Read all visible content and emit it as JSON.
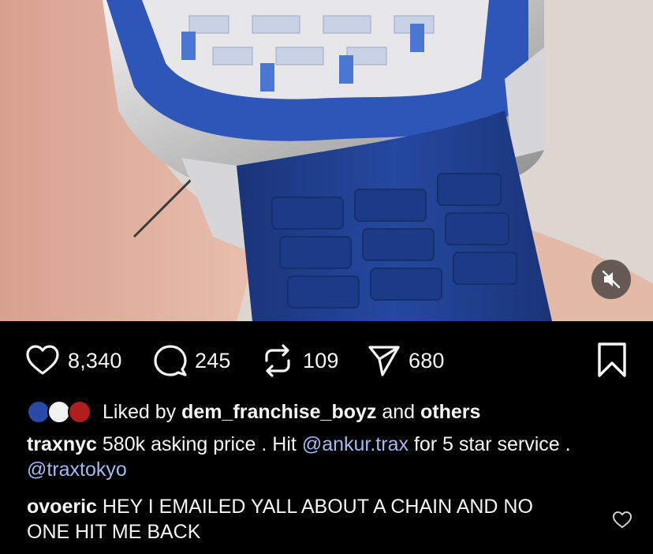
{
  "post": {
    "actions": {
      "likes": "8,340",
      "comments": "245",
      "reposts": "109",
      "shares": "680"
    },
    "liked_by": {
      "prefix": "Liked by",
      "user": "dem_franchise_boyz",
      "joiner": "and",
      "others": "others"
    },
    "caption": {
      "username": "traxnyc",
      "text_1": "580k asking price .  Hit ",
      "mention_1": "@ankur.trax",
      "text_2": " for 5 star service . ",
      "mention_2": "@traxtokyo"
    },
    "comment": {
      "username": "ovoeric",
      "text": "HEY I EMAILED YALL ABOUT A CHAIN AND NO ONE HIT ME BACK"
    }
  },
  "icons": {
    "like": "heart-icon",
    "comment": "comment-bubble-icon",
    "repost": "repost-icon",
    "share": "send-icon",
    "save": "bookmark-icon",
    "mute": "speaker-muted-icon"
  },
  "colors": {
    "background": "#000000",
    "text": "#f5f5f5",
    "mention": "#a7b8f0",
    "watch_strap": "#1f3f8f",
    "sapphire": "#3a62c9"
  }
}
